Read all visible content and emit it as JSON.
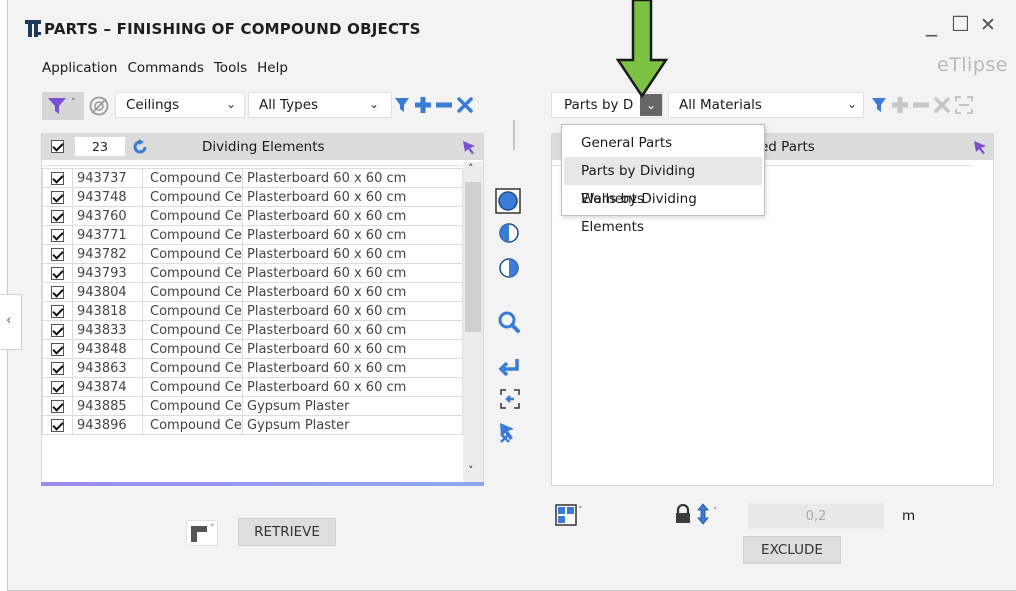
{
  "window": {
    "title": "PARTS – FINISHING OF COMPOUND OBJECTS",
    "brand": "eTlipse",
    "controls": {
      "minimize": "_",
      "maximize": "☐",
      "close": "✕"
    }
  },
  "menu": [
    "Application",
    "Commands",
    "Tools",
    "Help"
  ],
  "left": {
    "category": "Ceilings",
    "type": "All Types",
    "count": "23",
    "header_title": "Dividing Elements",
    "rows": [
      {
        "id": "943737",
        "name": "Compound Cei",
        "material": "Plasterboard 60 x 60 cm"
      },
      {
        "id": "943748",
        "name": "Compound Cei",
        "material": "Plasterboard 60 x 60 cm"
      },
      {
        "id": "943760",
        "name": "Compound Cei",
        "material": "Plasterboard 60 x 60 cm"
      },
      {
        "id": "943771",
        "name": "Compound Cei",
        "material": "Plasterboard 60 x 60 cm"
      },
      {
        "id": "943782",
        "name": "Compound Cei",
        "material": "Plasterboard 60 x 60 cm"
      },
      {
        "id": "943793",
        "name": "Compound Cei",
        "material": "Plasterboard 60 x 60 cm"
      },
      {
        "id": "943804",
        "name": "Compound Cei",
        "material": "Plasterboard 60 x 60 cm"
      },
      {
        "id": "943818",
        "name": "Compound Cei",
        "material": "Plasterboard 60 x 60 cm"
      },
      {
        "id": "943833",
        "name": "Compound Cei",
        "material": "Plasterboard 60 x 60 cm"
      },
      {
        "id": "943848",
        "name": "Compound Cei",
        "material": "Plasterboard 60 x 60 cm"
      },
      {
        "id": "943863",
        "name": "Compound Cei",
        "material": "Plasterboard 60 x 60 cm"
      },
      {
        "id": "943874",
        "name": "Compound Cei",
        "material": "Plasterboard 60 x 60 cm"
      },
      {
        "id": "943885",
        "name": "Compound Cei",
        "material": "Gypsum Plaster"
      },
      {
        "id": "943896",
        "name": "Compound Cei",
        "material": "Gypsum Plaster"
      }
    ],
    "retrieve_label": "RETRIEVE"
  },
  "right": {
    "mode": "Parts by D",
    "material": "All Materials",
    "header_title": "ved Parts",
    "dropdown_options": [
      "General Parts",
      "Parts by Dividing Elements",
      "Walls by Dividing Elements"
    ],
    "highlighted_option": "Parts by Dividing Elements",
    "value": "0,2",
    "unit": "m",
    "exclude_label": "EXCLUDE"
  },
  "colors": {
    "accent_purple": "#7b4fd0",
    "accent_blue": "#3a7bd5",
    "arrow_green": "#7cc242",
    "progress_stripe": "#8aa9ef"
  }
}
